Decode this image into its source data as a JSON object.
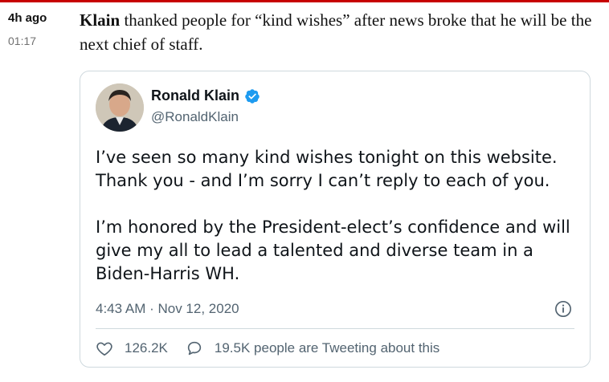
{
  "entry": {
    "time_ago": "4h ago",
    "timestamp": "01:17",
    "subject": "Klain",
    "text": " thanked people for “kind wishes” after news broke that he will be the next chief of staff."
  },
  "tweet": {
    "name": "Ronald Klain",
    "handle": "@RonaldKlain",
    "line1": "I’ve seen so many kind wishes tonight on this website.",
    "line2": "Thank you - and I’m sorry I can’t reply to each of you.",
    "line3": "I’m honored by the President-elect’s confidence and will",
    "line4": "give my all to lead a talented and diverse team in a",
    "line5": "Biden-Harris WH.",
    "date": "4:43 AM · Nov 12, 2020",
    "likes": "126.2K",
    "tweeting": "19.5K people are Tweeting about this"
  },
  "colors": {
    "accent_red": "#c70000",
    "verified_blue": "#1d9bf0",
    "muted_text": "#536471"
  }
}
